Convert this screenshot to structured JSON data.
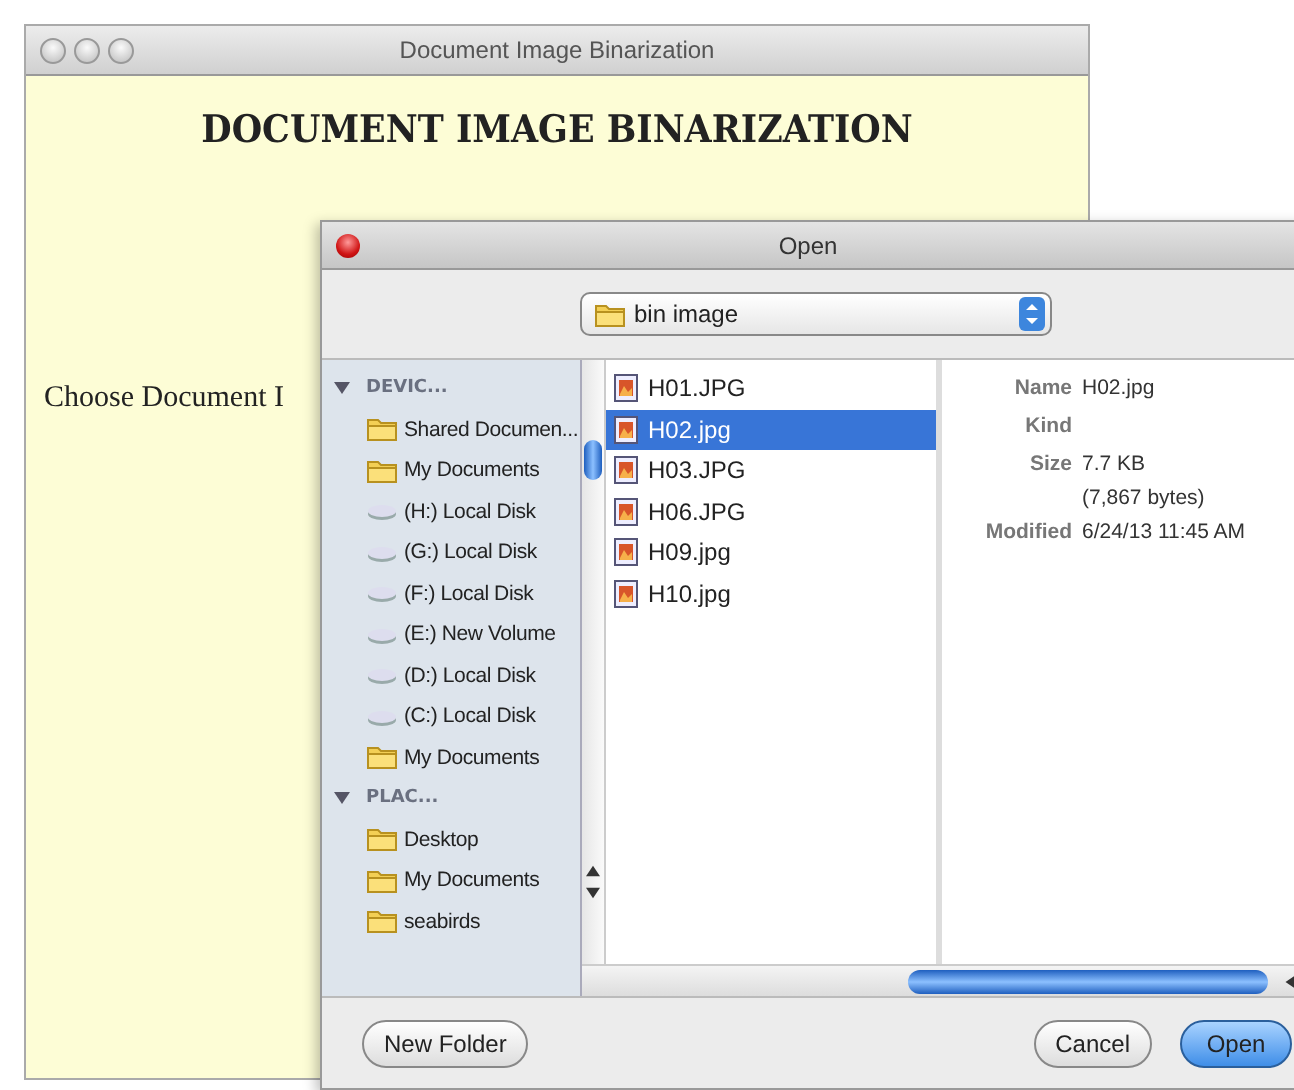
{
  "main_window": {
    "title": "Document Image Binarization",
    "heading": "DOCUMENT IMAGE BINARIZATION",
    "prompt": "Choose Document I"
  },
  "dialog": {
    "title": "Open",
    "location": {
      "label": "bin image"
    },
    "sidebar": [
      {
        "label": "DEVIC...",
        "expanded": true,
        "items": [
          {
            "label": "Shared Documen...",
            "kind": "folder"
          },
          {
            "label": "My Documents",
            "kind": "folder"
          },
          {
            "label": "(H:) Local Disk",
            "kind": "disk"
          },
          {
            "label": "(G:) Local Disk",
            "kind": "disk"
          },
          {
            "label": "(F:) Local Disk",
            "kind": "disk"
          },
          {
            "label": "(E:) New Volume",
            "kind": "disk"
          },
          {
            "label": "(D:) Local Disk",
            "kind": "disk"
          },
          {
            "label": "(C:) Local Disk",
            "kind": "disk"
          },
          {
            "label": "My Documents",
            "kind": "folder"
          }
        ]
      },
      {
        "label": "PLAC...",
        "expanded": true,
        "items": [
          {
            "label": "Desktop",
            "kind": "folder"
          },
          {
            "label": "My Documents",
            "kind": "folder"
          },
          {
            "label": "seabirds",
            "kind": "folder"
          }
        ]
      }
    ],
    "files": [
      {
        "name": "H01.JPG",
        "selected": false
      },
      {
        "name": "H02.jpg",
        "selected": true
      },
      {
        "name": "H03.JPG",
        "selected": false
      },
      {
        "name": "H06.JPG",
        "selected": false
      },
      {
        "name": "H09.jpg",
        "selected": false
      },
      {
        "name": "H10.jpg",
        "selected": false
      }
    ],
    "preview": [
      {
        "label": "Name",
        "lines": [
          "H02.jpg"
        ]
      },
      {
        "label": "Kind"
      },
      {
        "label": "Size",
        "lines": [
          "7.7 KB",
          "(7,867 bytes)"
        ]
      },
      {
        "label": "Modified",
        "lines": [
          "6/24/13 11:45 AM"
        ]
      }
    ],
    "buttons": [
      {
        "label": "New Folder",
        "kind": "secondary"
      },
      {
        "label": "Cancel",
        "kind": "secondary"
      },
      {
        "label": "Open",
        "kind": "default"
      }
    ]
  }
}
